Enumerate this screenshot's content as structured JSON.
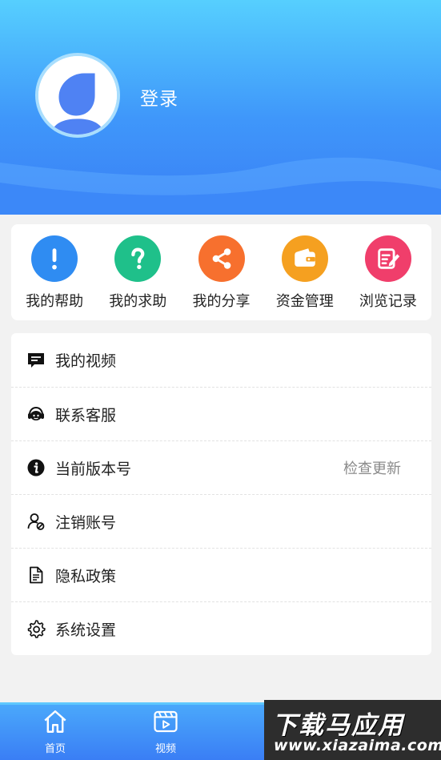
{
  "header": {
    "login_label": "登录",
    "gradient_top": "#56cffe",
    "gradient_bottom": "#3a7ff5"
  },
  "quick_actions": [
    {
      "label": "我的帮助",
      "icon": "exclamation-icon",
      "color": "#2f8cf2"
    },
    {
      "label": "我的求助",
      "icon": "question-icon",
      "color": "#1fc08a"
    },
    {
      "label": "我的分享",
      "icon": "share-icon",
      "color": "#f7702e"
    },
    {
      "label": "资金管理",
      "icon": "wallet-icon",
      "color": "#f5a020"
    },
    {
      "label": "浏览记录",
      "icon": "edit-note-icon",
      "color": "#f03e6b"
    }
  ],
  "menu": [
    {
      "label": "我的视频",
      "icon": "message-icon",
      "right": ""
    },
    {
      "label": "联系客服",
      "icon": "customer-service-icon",
      "right": ""
    },
    {
      "label": "当前版本号",
      "icon": "info-icon",
      "right": "检查更新"
    },
    {
      "label": "注销账号",
      "icon": "user-remove-icon",
      "right": ""
    },
    {
      "label": "隐私政策",
      "icon": "document-icon",
      "right": ""
    },
    {
      "label": "系统设置",
      "icon": "gear-icon",
      "right": ""
    }
  ],
  "bottom_nav": [
    {
      "label": "首页",
      "icon": "home-icon"
    },
    {
      "label": "视频",
      "icon": "video-icon"
    }
  ],
  "watermark": {
    "main": "下载马应用",
    "sub": "www.xiazaima.com"
  }
}
